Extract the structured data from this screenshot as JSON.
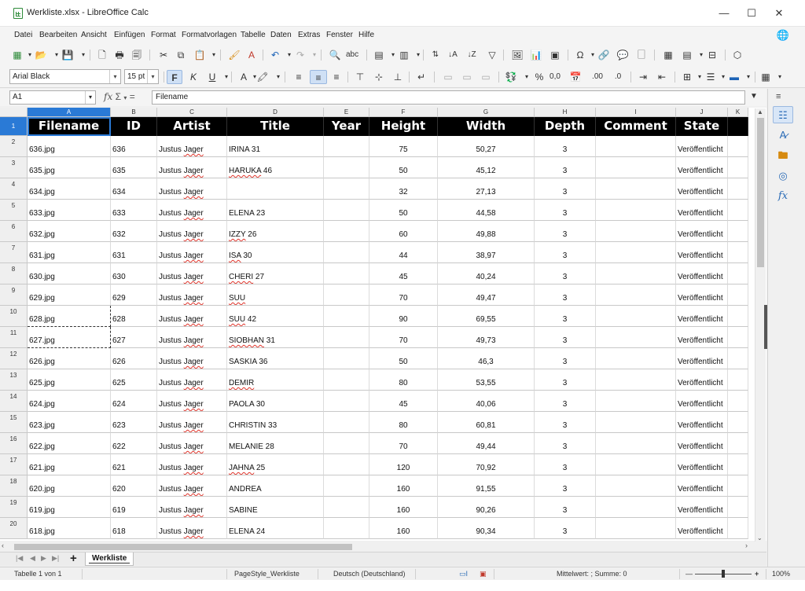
{
  "window": {
    "title": "Werkliste.xlsx - LibreOffice Calc",
    "minimize": "—",
    "maximize": "☐",
    "close": "✕"
  },
  "menu": [
    "Datei",
    "Bearbeiten",
    "Ansicht",
    "Einfügen",
    "Format",
    "Formatvorlagen",
    "Tabelle",
    "Daten",
    "Extras",
    "Fenster",
    "Hilfe"
  ],
  "format_bar": {
    "font_name": "Arial Black",
    "font_size": "15 pt",
    "bold": "F",
    "italic": "K",
    "underline": "U",
    "percent": "%",
    "number_format": "0,0"
  },
  "formula_bar": {
    "cell_ref": "A1",
    "content": "Filename",
    "fx": "fx",
    "sum": "Σ",
    "equals": "="
  },
  "columns": [
    "A",
    "B",
    "C",
    "D",
    "E",
    "F",
    "G",
    "H",
    "I",
    "J",
    "K"
  ],
  "headers": [
    "Filename",
    "ID",
    "Artist",
    "Title",
    "Year",
    "Height",
    "Width",
    "Depth",
    "Comment",
    "State"
  ],
  "rows": [
    {
      "n": "2",
      "file": "636.jpg",
      "id": "636",
      "artist": "Justus Jager",
      "title": "IRINA 31",
      "height": "75",
      "width": "50,27",
      "depth": "3",
      "state": "Veröffentlicht"
    },
    {
      "n": "3",
      "file": "635.jpg",
      "id": "635",
      "artist": "Justus Jager",
      "title": "HARUKA 46",
      "height": "50",
      "width": "45,12",
      "depth": "3",
      "state": "Veröffentlicht"
    },
    {
      "n": "4",
      "file": "634.jpg",
      "id": "634",
      "artist": "Justus Jager",
      "title": "",
      "height": "32",
      "width": "27,13",
      "depth": "3",
      "state": "Veröffentlicht"
    },
    {
      "n": "5",
      "file": "633.jpg",
      "id": "633",
      "artist": "Justus Jager",
      "title": "ELENA 23",
      "height": "50",
      "width": "44,58",
      "depth": "3",
      "state": "Veröffentlicht"
    },
    {
      "n": "6",
      "file": "632.jpg",
      "id": "632",
      "artist": "Justus Jager",
      "title": "IZZY 26",
      "height": "60",
      "width": "49,88",
      "depth": "3",
      "state": "Veröffentlicht"
    },
    {
      "n": "7",
      "file": "631.jpg",
      "id": "631",
      "artist": "Justus Jager",
      "title": "ISA 30",
      "height": "44",
      "width": "38,97",
      "depth": "3",
      "state": "Veröffentlicht"
    },
    {
      "n": "8",
      "file": "630.jpg",
      "id": "630",
      "artist": "Justus Jager",
      "title": "CHERI 27",
      "height": "45",
      "width": "40,24",
      "depth": "3",
      "state": "Veröffentlicht"
    },
    {
      "n": "9",
      "file": "629.jpg",
      "id": "629",
      "artist": "Justus Jager",
      "title": "SUU",
      "height": "70",
      "width": "49,47",
      "depth": "3",
      "state": "Veröffentlicht"
    },
    {
      "n": "10",
      "file": "628.jpg",
      "id": "628",
      "artist": "Justus Jager",
      "title": "SUU 42",
      "height": "90",
      "width": "69,55",
      "depth": "3",
      "state": "Veröffentlicht"
    },
    {
      "n": "11",
      "file": "627.jpg",
      "id": "627",
      "artist": "Justus Jager",
      "title": "SIOBHAN 31",
      "height": "70",
      "width": "49,73",
      "depth": "3",
      "state": "Veröffentlicht"
    },
    {
      "n": "12",
      "file": "626.jpg",
      "id": "626",
      "artist": "Justus Jager",
      "title": "SASKIA 36",
      "height": "50",
      "width": "46,3",
      "depth": "3",
      "state": "Veröffentlicht"
    },
    {
      "n": "13",
      "file": "625.jpg",
      "id": "625",
      "artist": "Justus Jager",
      "title": "DEMIR",
      "height": "80",
      "width": "53,55",
      "depth": "3",
      "state": "Veröffentlicht"
    },
    {
      "n": "14",
      "file": "624.jpg",
      "id": "624",
      "artist": "Justus Jager",
      "title": "PAOLA 30",
      "height": "45",
      "width": "40,06",
      "depth": "3",
      "state": "Veröffentlicht"
    },
    {
      "n": "15",
      "file": "623.jpg",
      "id": "623",
      "artist": "Justus Jager",
      "title": "CHRISTIN 33",
      "height": "80",
      "width": "60,81",
      "depth": "3",
      "state": "Veröffentlicht"
    },
    {
      "n": "16",
      "file": "622.jpg",
      "id": "622",
      "artist": "Justus Jager",
      "title": "MELANIE 28",
      "height": "70",
      "width": "49,44",
      "depth": "3",
      "state": "Veröffentlicht"
    },
    {
      "n": "17",
      "file": "621.jpg",
      "id": "621",
      "artist": "Justus Jager",
      "title": "JAHNA 25",
      "height": "120",
      "width": "70,92",
      "depth": "3",
      "state": "Veröffentlicht"
    },
    {
      "n": "18",
      "file": "620.jpg",
      "id": "620",
      "artist": "Justus Jager",
      "title": "ANDREA",
      "height": "160",
      "width": "91,55",
      "depth": "3",
      "state": "Veröffentlicht"
    },
    {
      "n": "19",
      "file": "619.jpg",
      "id": "619",
      "artist": "Justus Jager",
      "title": "SABINE",
      "height": "160",
      "width": "90,26",
      "depth": "3",
      "state": "Veröffentlicht"
    },
    {
      "n": "20",
      "file": "618.jpg",
      "id": "618",
      "artist": "Justus Jager",
      "title": "ELENA 24",
      "height": "160",
      "width": "90,34",
      "depth": "3",
      "state": "Veröffentlicht"
    }
  ],
  "header_row_number": "1",
  "sheet_tab": "Werkliste",
  "status": {
    "sheet_info": "Tabelle 1 von 1",
    "page_style": "PageStyle_Werkliste",
    "language": "Deutsch (Deutschland)",
    "selection_stats": "Mittelwert: ; Summe: 0",
    "zoom": "100%"
  },
  "colors": {
    "header_bg": "#000000",
    "header_text": "#ffffff",
    "selection": "#2a7ad6",
    "spell_underline": "#e0342a"
  }
}
